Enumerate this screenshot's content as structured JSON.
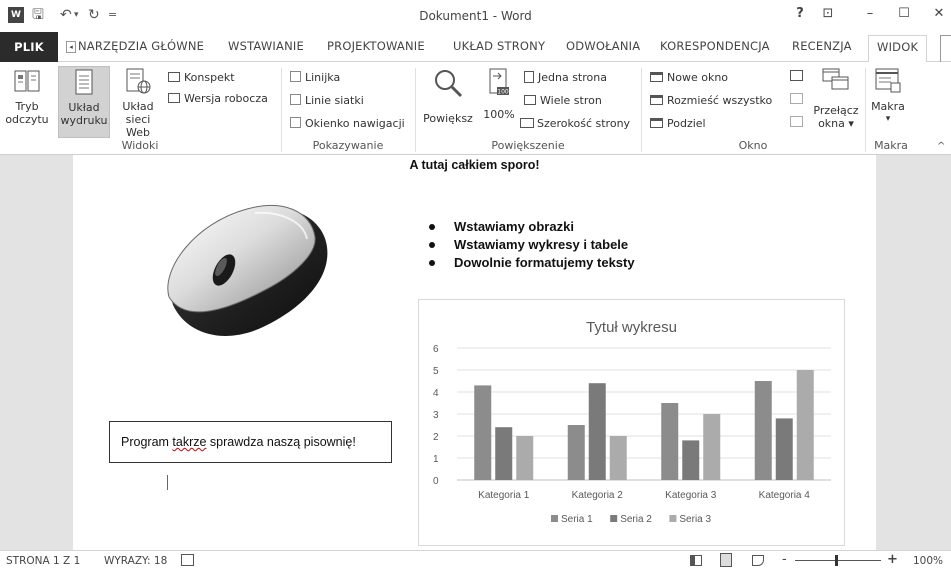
{
  "window": {
    "title": "Dokument1 - Word",
    "help_glyph": "?",
    "ribbon_options_glyph": "⊡",
    "minimize_glyph": "–",
    "maximize_glyph": "☐",
    "close_glyph": "✕"
  },
  "quick_access": {
    "app_icon_label": "W",
    "save_glyph": "🖫",
    "undo_glyph": "↶",
    "undo_caret": "▾",
    "redo_glyph": "↻",
    "customize_glyph": "="
  },
  "tabs": {
    "file": "PLIK",
    "scroll_left_glyph": "◂",
    "items": [
      "NARZĘDZIA GŁÓWNE",
      "WSTAWIANIE",
      "PROJEKTOWANIE",
      "UKŁAD STRONY",
      "ODWOŁANIA",
      "KORESPONDENCJA",
      "RECENZJA",
      "WIDOK"
    ],
    "active": "WIDOK"
  },
  "ribbon": {
    "views": {
      "label": "Widoki",
      "read_mode": {
        "line1": "Tryb",
        "line2": "odczytu"
      },
      "print_layout": {
        "line1": "Układ",
        "line2": "wydruku"
      },
      "web_layout": {
        "line1": "Układ",
        "line2": "sieci Web"
      },
      "outline": "Konspekt",
      "draft": "Wersja robocza"
    },
    "show": {
      "label": "Pokazywanie",
      "ruler": "Linijka",
      "gridlines": "Linie siatki",
      "nav_pane": "Okienko nawigacji"
    },
    "zoom": {
      "label": "Powiększenie",
      "zoom": "Powiększ",
      "hundred": "100%",
      "one_page": "Jedna strona",
      "multiple_pages": "Wiele stron",
      "page_width": "Szerokość strony"
    },
    "window": {
      "label": "Okno",
      "new_window": "Nowe okno",
      "arrange_all": "Rozmieść wszystko",
      "split": "Podziel",
      "switch_windows": {
        "line1": "Przełącz",
        "line2": "okna ▾"
      }
    },
    "macros": {
      "label": "Makra",
      "button": "Makra",
      "caret": "▾"
    },
    "collapse_glyph": "^"
  },
  "document": {
    "heading": "A tutaj całkiem sporo!",
    "bullets": [
      "Wstawiamy obrazki",
      "Wstawiamy wykresy i tabele",
      "Dowolnie formatujemy teksty"
    ],
    "textbox": {
      "before": "Program ",
      "misspelled": "takrze",
      "after": " sprawdza naszą pisownię!"
    }
  },
  "chart_data": {
    "type": "bar",
    "title": "Tytuł wykresu",
    "categories": [
      "Kategoria 1",
      "Kategoria 2",
      "Kategoria 3",
      "Kategoria 4"
    ],
    "series": [
      {
        "name": "Seria 1",
        "values": [
          4.3,
          2.5,
          3.5,
          4.5
        ],
        "color": "#8c8c8c"
      },
      {
        "name": "Seria 2",
        "values": [
          2.4,
          4.4,
          1.8,
          2.8
        ],
        "color": "#7a7a7a"
      },
      {
        "name": "Seria 3",
        "values": [
          2.0,
          2.0,
          3.0,
          5.0
        ],
        "color": "#ababab"
      }
    ],
    "ylim": [
      0,
      6
    ],
    "yticks": [
      0,
      1,
      2,
      3,
      4,
      5,
      6
    ],
    "grid": true,
    "legend": "bottom"
  },
  "statusbar": {
    "page": "STRONA 1 Z 1",
    "words": "WYRAZY: 18",
    "zoom_minus": "-",
    "zoom_plus": "+",
    "zoom_level": "100%"
  }
}
